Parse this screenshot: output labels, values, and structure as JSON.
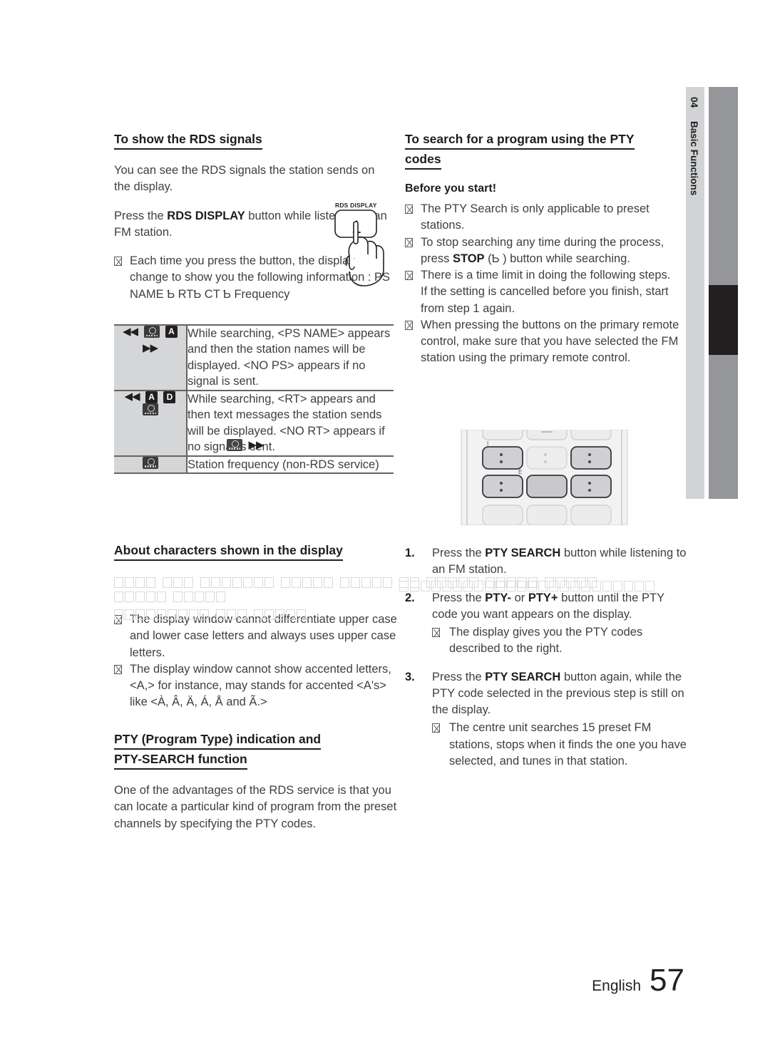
{
  "page": {
    "language_label": "English",
    "page_number": "57",
    "footer_left": "HT-D5759W_ZG_0323.indd   57",
    "footer_right": "2011-03-23    10:03:36"
  },
  "chapter_tab": {
    "number": "04",
    "title": "Basic Functions",
    "colors": {
      "light_strip": "#d2d3d5",
      "grey_strip": "#949699",
      "active_block": "#231f20"
    }
  },
  "left_column": {
    "section1": {
      "heading": "To show the RDS signals",
      "paragraph1": "You can see the RDS signals the station sends on the display.",
      "paragraph2_pre": "Press the ",
      "paragraph2_bold": "RDS DISPLAY",
      "paragraph2_post": " button while listening to an FM station.",
      "note1": "Each time you press the button, the display change to show you the following information : PS NAME Ƅ RTƄ  CT Ƅ  Frequency",
      "hand_figure_caption": "RDS DISPLAY",
      "hand_figure_key": "1"
    },
    "rds_table": {
      "rows": [
        {
          "icons": [
            "rew-arrow",
            "audio-cd-key",
            "A-key",
            "ff-arrow"
          ],
          "description": "While searching, <PS NAME> appears and then the station names will be displayed. <NO PS> appears if no signal is sent."
        },
        {
          "icons": [
            "rew-arrow",
            "A-key",
            "D-key",
            "audio-cd-key",
            "disc-key",
            "ff-arrow"
          ],
          "description": "While searching, <RT> appears and then text messages the station sends will be displayed. <NO RT> appears if no signal is sent."
        },
        {
          "icons": [
            "audio-cd-key"
          ],
          "description": "Station frequency (non-RDS service)"
        }
      ]
    },
    "section2": {
      "heading": "About characters shown in the display",
      "garbled_paragraph_boxes_line1": 31,
      "garbled_paragraph_boxes_line2": 18,
      "note1": "The display window cannot differentiate upper case and lower case letters and always uses upper case letters.",
      "note2": "The display window cannot show accented letters, <A,> for instance, may stands for accented <A's> like <À, Â, Ä, Á, Å and Ã.>"
    },
    "section3": {
      "heading_line1": "PTY (Program Type) indication and",
      "heading_line2": "PTY-SEARCH function",
      "paragraph": "One of the advantages of the RDS service is that you can locate a particular kind of program from the preset channels by specifying the PTY codes."
    }
  },
  "right_column": {
    "section1": {
      "heading_line1": "To search for a program using the PTY",
      "heading_line2": "codes",
      "subheading": "Before you start!",
      "notes": [
        {
          "text": "The PTY Search is only applicable to preset stations."
        },
        {
          "pre": "To stop searching any time during the process, press ",
          "bold": "STOP",
          "post": " (Ƅ ) button while searching."
        },
        {
          "text": "There is a time limit in doing the following steps.",
          "continuation": "If the setting is cancelled before you finish, start from step 1 again."
        },
        {
          "text": "When pressing the buttons on the primary remote control, make sure that you have selected the FM station using the primary remote control."
        }
      ]
    },
    "steps": [
      {
        "number": "1.",
        "pre": "Press the ",
        "bold": "PTY SEARCH",
        "post": " button while listening to an FM station.",
        "notes": []
      },
      {
        "number": "2.",
        "pre": "Press the ",
        "bold": "PTY-",
        "mid": " or ",
        "bold2": "PTY+",
        "post": " button until the PTY code you want appears on the display.",
        "notes": [
          "The display gives you the PTY codes described to the right."
        ]
      },
      {
        "number": "3.",
        "pre": "Press the ",
        "bold": "PTY SEARCH",
        "post": " button again, while the PTY code selected in the previous step is still on the display.",
        "notes": [
          "The centre unit searches 15 preset FM stations, stops when it finds the one you have selected, and tunes in that station."
        ]
      }
    ],
    "remote_figure": {
      "label_top": "I",
      "label_mid": "E"
    }
  },
  "garbled_strip_boxes": 24
}
